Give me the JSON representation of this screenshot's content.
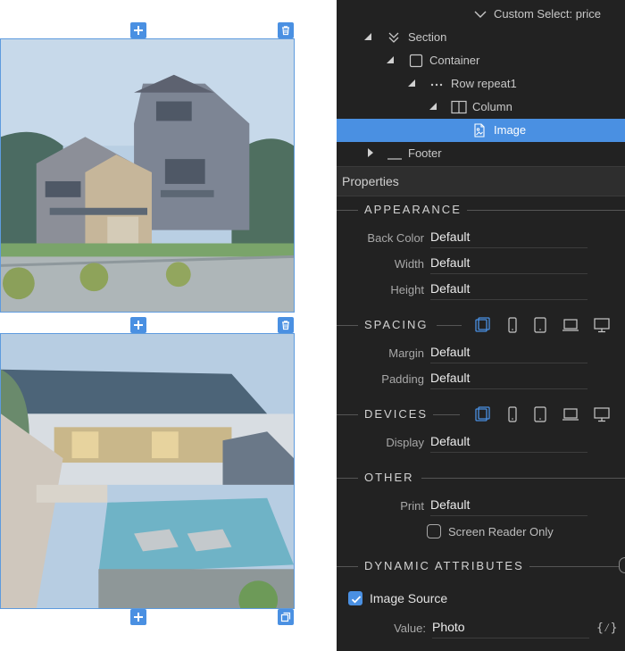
{
  "canvas": {
    "image1_alt": "House exterior",
    "image2_alt": "Pool courtyard"
  },
  "tree": {
    "custom_select": "Custom Select: price",
    "section": "Section",
    "container": "Container",
    "row": "Row repeat1",
    "column": "Column",
    "image": "Image",
    "footer": "Footer"
  },
  "properties": {
    "header": "Properties",
    "appearance": {
      "title": "APPEARANCE",
      "back_color_label": "Back Color",
      "back_color_value": "Default",
      "width_label": "Width",
      "width_value": "Default",
      "height_label": "Height",
      "height_value": "Default"
    },
    "spacing": {
      "title": "SPACING",
      "margin_label": "Margin",
      "margin_value": "Default",
      "padding_label": "Padding",
      "padding_value": "Default"
    },
    "devices": {
      "title": "DEVICES",
      "display_label": "Display",
      "display_value": "Default"
    },
    "other": {
      "title": "OTHER",
      "print_label": "Print",
      "print_value": "Default",
      "screen_reader_label": "Screen Reader Only"
    },
    "dynamic": {
      "title": "DYNAMIC ATTRIBUTES",
      "image_source_label": "Image Source",
      "value_label": "Value:",
      "value_value": "Photo",
      "expr_icon_text": "{⁄}"
    }
  },
  "colors": {
    "accent": "#4a90e2",
    "panel_bg": "#222222"
  }
}
